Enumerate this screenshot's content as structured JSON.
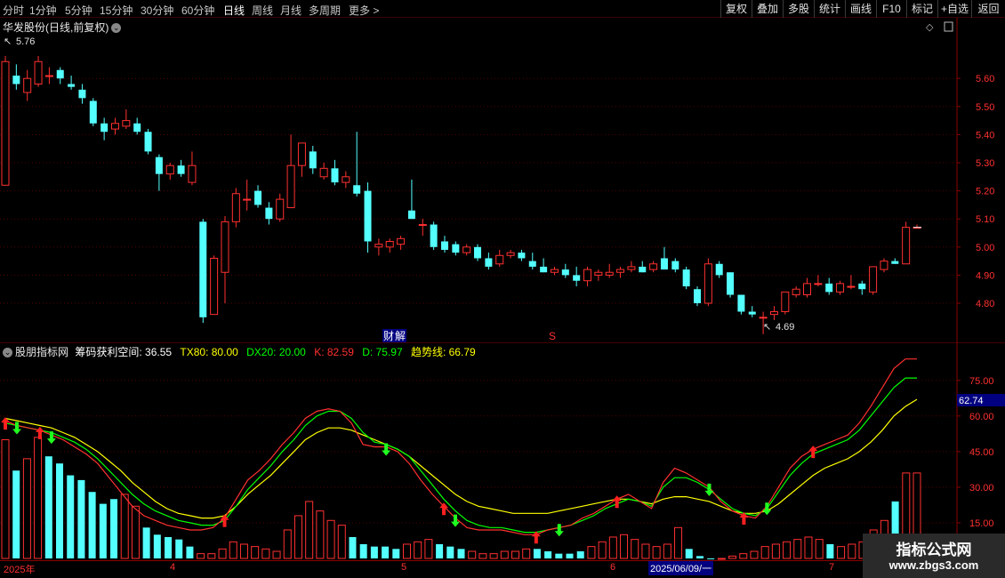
{
  "toolbar": {
    "timeframes": [
      "分时",
      "1分钟",
      "5分钟",
      "15分钟",
      "30分钟",
      "60分钟",
      "日线",
      "周线",
      "月线",
      "多周期",
      "更多 >"
    ],
    "active_timeframe": "日线",
    "right_buttons": [
      "复权",
      "叠加",
      "多股",
      "统计",
      "画线",
      "F10",
      "标记",
      "+自选",
      "返回"
    ]
  },
  "main": {
    "title": "华发股份(日线,前复权)",
    "high_label": "5.76",
    "low_label": "4.69",
    "price_ticks": [
      "5.60",
      "5.50",
      "5.40",
      "5.30",
      "5.20",
      "5.10",
      "5.00",
      "4.90",
      "4.80"
    ],
    "event_caiji": "财",
    "event_jie": "解",
    "event_s": "S"
  },
  "indicator": {
    "name": "股朋指标网",
    "items": [
      {
        "label": "筹码获利空间: 36.55",
        "color": "#ffffff"
      },
      {
        "label": "TX80: 80.00",
        "color": "#ffff00"
      },
      {
        "label": "DX20: 20.00",
        "color": "#00ff00"
      },
      {
        "label": "K: 82.59",
        "color": "#ff3030"
      },
      {
        "label": "D: 75.97",
        "color": "#00ff00"
      },
      {
        "label": "趋势线: 66.79",
        "color": "#ffff00"
      }
    ],
    "ticks": [
      "75.00",
      "60.00",
      "45.00",
      "30.00",
      "15.00"
    ],
    "current_value": "62.74"
  },
  "xaxis": {
    "labels": [
      "2025年",
      "4",
      "5",
      "6",
      "2025/06/09/一",
      "7"
    ]
  },
  "watermark": {
    "line1": "指标公式网",
    "line2": "www.zbgs3.com"
  },
  "colors": {
    "up": "#ff3030",
    "down": "#54ffff",
    "grid": "#8b0000",
    "k_line": "#ff3030",
    "d_line": "#00ff00",
    "trend_line": "#ffff00"
  },
  "chart_data": [
    {
      "type": "candlestick",
      "title": "华发股份(日线,前复权)",
      "ylim": [
        4.69,
        5.76
      ],
      "candles": [
        {
          "o": 5.22,
          "h": 5.68,
          "l": 5.22,
          "c": 5.66
        },
        {
          "o": 5.61,
          "h": 5.65,
          "l": 5.56,
          "c": 5.58
        },
        {
          "o": 5.55,
          "h": 5.63,
          "l": 5.52,
          "c": 5.6
        },
        {
          "o": 5.58,
          "h": 5.68,
          "l": 5.57,
          "c": 5.66
        },
        {
          "o": 5.61,
          "h": 5.64,
          "l": 5.58,
          "c": 5.61
        },
        {
          "o": 5.63,
          "h": 5.64,
          "l": 5.58,
          "c": 5.6
        },
        {
          "o": 5.58,
          "h": 5.61,
          "l": 5.56,
          "c": 5.57
        },
        {
          "o": 5.56,
          "h": 5.58,
          "l": 5.51,
          "c": 5.53
        },
        {
          "o": 5.52,
          "h": 5.53,
          "l": 5.43,
          "c": 5.44
        },
        {
          "o": 5.44,
          "h": 5.46,
          "l": 5.38,
          "c": 5.41
        },
        {
          "o": 5.42,
          "h": 5.46,
          "l": 5.4,
          "c": 5.44
        },
        {
          "o": 5.43,
          "h": 5.49,
          "l": 5.42,
          "c": 5.45
        },
        {
          "o": 5.44,
          "h": 5.46,
          "l": 5.4,
          "c": 5.41
        },
        {
          "o": 5.41,
          "h": 5.42,
          "l": 5.33,
          "c": 5.34
        },
        {
          "o": 5.32,
          "h": 5.33,
          "l": 5.2,
          "c": 5.26
        },
        {
          "o": 5.26,
          "h": 5.3,
          "l": 5.24,
          "c": 5.29
        },
        {
          "o": 5.29,
          "h": 5.31,
          "l": 5.25,
          "c": 5.26
        },
        {
          "o": 5.23,
          "h": 5.34,
          "l": 5.22,
          "c": 5.29
        },
        {
          "o": 5.09,
          "h": 5.1,
          "l": 4.73,
          "c": 4.75
        },
        {
          "o": 4.76,
          "h": 4.97,
          "l": 4.76,
          "c": 4.96
        },
        {
          "o": 4.91,
          "h": 5.11,
          "l": 4.8,
          "c": 5.09
        },
        {
          "o": 5.09,
          "h": 5.21,
          "l": 5.07,
          "c": 5.19
        },
        {
          "o": 5.17,
          "h": 5.24,
          "l": 5.13,
          "c": 5.17
        },
        {
          "o": 5.2,
          "h": 5.22,
          "l": 5.14,
          "c": 5.15
        },
        {
          "o": 5.14,
          "h": 5.16,
          "l": 5.08,
          "c": 5.1
        },
        {
          "o": 5.1,
          "h": 5.19,
          "l": 5.09,
          "c": 5.17
        },
        {
          "o": 5.14,
          "h": 5.4,
          "l": 5.14,
          "c": 5.29
        },
        {
          "o": 5.29,
          "h": 5.37,
          "l": 5.25,
          "c": 5.37
        },
        {
          "o": 5.34,
          "h": 5.36,
          "l": 5.26,
          "c": 5.28
        },
        {
          "o": 5.25,
          "h": 5.3,
          "l": 5.24,
          "c": 5.28
        },
        {
          "o": 5.28,
          "h": 5.31,
          "l": 5.22,
          "c": 5.23
        },
        {
          "o": 5.23,
          "h": 5.27,
          "l": 5.21,
          "c": 5.25
        },
        {
          "o": 5.22,
          "h": 5.41,
          "l": 5.18,
          "c": 5.19
        },
        {
          "o": 5.2,
          "h": 5.23,
          "l": 4.98,
          "c": 5.02
        },
        {
          "o": 5.0,
          "h": 5.03,
          "l": 4.97,
          "c": 5.01
        },
        {
          "o": 5.0,
          "h": 5.03,
          "l": 4.98,
          "c": 5.02
        },
        {
          "o": 5.01,
          "h": 5.04,
          "l": 4.99,
          "c": 5.03
        },
        {
          "o": 5.13,
          "h": 5.24,
          "l": 5.1,
          "c": 5.1
        },
        {
          "o": 5.08,
          "h": 5.1,
          "l": 5.04,
          "c": 5.08
        },
        {
          "o": 5.08,
          "h": 5.09,
          "l": 4.99,
          "c": 5.0
        },
        {
          "o": 5.02,
          "h": 5.04,
          "l": 4.98,
          "c": 4.99
        },
        {
          "o": 5.01,
          "h": 5.02,
          "l": 4.97,
          "c": 4.98
        },
        {
          "o": 4.98,
          "h": 5.01,
          "l": 4.97,
          "c": 5.0
        },
        {
          "o": 5.0,
          "h": 5.01,
          "l": 4.95,
          "c": 4.96
        },
        {
          "o": 4.96,
          "h": 4.98,
          "l": 4.92,
          "c": 4.93
        },
        {
          "o": 4.94,
          "h": 4.99,
          "l": 4.93,
          "c": 4.97
        },
        {
          "o": 4.97,
          "h": 4.99,
          "l": 4.96,
          "c": 4.98
        },
        {
          "o": 4.98,
          "h": 4.99,
          "l": 4.95,
          "c": 4.96
        },
        {
          "o": 4.95,
          "h": 4.98,
          "l": 4.92,
          "c": 4.93
        },
        {
          "o": 4.93,
          "h": 4.96,
          "l": 4.91,
          "c": 4.91
        },
        {
          "o": 4.91,
          "h": 4.93,
          "l": 4.9,
          "c": 4.92
        },
        {
          "o": 4.92,
          "h": 4.94,
          "l": 4.89,
          "c": 4.9
        },
        {
          "o": 4.9,
          "h": 4.93,
          "l": 4.86,
          "c": 4.88
        },
        {
          "o": 4.88,
          "h": 4.93,
          "l": 4.86,
          "c": 4.92
        },
        {
          "o": 4.9,
          "h": 4.92,
          "l": 4.88,
          "c": 4.91
        },
        {
          "o": 4.9,
          "h": 4.94,
          "l": 4.89,
          "c": 4.91
        },
        {
          "o": 4.91,
          "h": 4.93,
          "l": 4.89,
          "c": 4.92
        },
        {
          "o": 4.92,
          "h": 4.95,
          "l": 4.91,
          "c": 4.93
        },
        {
          "o": 4.93,
          "h": 4.95,
          "l": 4.91,
          "c": 4.91
        },
        {
          "o": 4.92,
          "h": 4.95,
          "l": 4.91,
          "c": 4.94
        },
        {
          "o": 4.96,
          "h": 5.0,
          "l": 4.95,
          "c": 4.92
        },
        {
          "o": 4.95,
          "h": 4.96,
          "l": 4.91,
          "c": 4.92
        },
        {
          "o": 4.92,
          "h": 4.93,
          "l": 4.85,
          "c": 4.86
        },
        {
          "o": 4.85,
          "h": 4.86,
          "l": 4.79,
          "c": 4.8
        },
        {
          "o": 4.8,
          "h": 4.96,
          "l": 4.79,
          "c": 4.94
        },
        {
          "o": 4.94,
          "h": 4.95,
          "l": 4.89,
          "c": 4.9
        },
        {
          "o": 4.91,
          "h": 4.91,
          "l": 4.82,
          "c": 4.83
        },
        {
          "o": 4.83,
          "h": 4.83,
          "l": 4.76,
          "c": 4.77
        },
        {
          "o": 4.77,
          "h": 4.79,
          "l": 4.75,
          "c": 4.76
        },
        {
          "o": 4.75,
          "h": 4.77,
          "l": 4.69,
          "c": 4.75
        },
        {
          "o": 4.76,
          "h": 4.79,
          "l": 4.74,
          "c": 4.77
        },
        {
          "o": 4.77,
          "h": 4.81,
          "l": 4.76,
          "c": 4.84
        },
        {
          "o": 4.83,
          "h": 4.86,
          "l": 4.82,
          "c": 4.85
        },
        {
          "o": 4.83,
          "h": 4.89,
          "l": 4.82,
          "c": 4.87
        },
        {
          "o": 4.87,
          "h": 4.9,
          "l": 4.86,
          "c": 4.87
        },
        {
          "o": 4.87,
          "h": 4.89,
          "l": 4.83,
          "c": 4.84
        },
        {
          "o": 4.84,
          "h": 4.88,
          "l": 4.83,
          "c": 4.87
        },
        {
          "o": 4.86,
          "h": 4.9,
          "l": 4.85,
          "c": 4.86
        },
        {
          "o": 4.87,
          "h": 4.88,
          "l": 4.83,
          "c": 4.85
        },
        {
          "o": 4.84,
          "h": 4.9,
          "l": 4.83,
          "c": 4.93
        },
        {
          "o": 4.92,
          "h": 4.96,
          "l": 4.91,
          "c": 4.95
        },
        {
          "o": 4.95,
          "h": 4.96,
          "l": 4.94,
          "c": 4.94
        },
        {
          "o": 4.94,
          "h": 5.09,
          "l": 4.94,
          "c": 5.07
        },
        {
          "o": 5.07,
          "h": 5.08,
          "l": 5.07,
          "c": 5.07
        }
      ]
    },
    {
      "type": "bar+line",
      "title": "股朋指标网",
      "ylim": [
        0,
        90
      ],
      "bar_values": [
        50,
        37,
        42,
        51,
        43,
        40,
        35,
        33,
        28,
        23,
        25,
        27,
        22,
        13,
        10,
        9,
        8,
        5,
        2,
        2,
        4,
        7,
        6,
        5,
        4,
        3,
        12,
        18,
        24,
        20,
        16,
        14,
        9,
        6,
        5,
        5,
        4,
        6,
        7,
        8,
        6,
        5,
        4,
        3,
        2,
        2,
        3,
        3,
        4,
        4,
        3,
        2,
        2,
        3,
        5,
        7,
        9,
        10,
        8,
        6,
        5,
        6,
        13,
        4,
        1,
        0,
        0,
        1,
        2,
        3,
        5,
        6,
        7,
        8,
        9,
        8,
        6,
        5,
        6,
        7,
        12,
        16,
        24,
        36,
        36
      ],
      "bar_up": [
        1,
        0,
        1,
        1,
        0,
        0,
        0,
        0,
        0,
        0,
        0,
        1,
        1,
        0,
        0,
        0,
        0,
        0,
        1,
        1,
        1,
        1,
        1,
        1,
        1,
        1,
        1,
        1,
        1,
        1,
        1,
        1,
        0,
        0,
        0,
        0,
        0,
        1,
        1,
        1,
        0,
        0,
        0,
        1,
        1,
        1,
        1,
        1,
        1,
        0,
        0,
        0,
        0,
        0,
        1,
        1,
        1,
        1,
        1,
        1,
        1,
        1,
        1,
        0,
        0,
        0,
        1,
        1,
        1,
        1,
        1,
        1,
        1,
        1,
        1,
        1,
        0,
        1,
        1,
        1,
        1,
        1,
        0,
        1,
        1
      ],
      "K": [
        58,
        56,
        55,
        54,
        52,
        50,
        47,
        44,
        40,
        34,
        28,
        22,
        18,
        16,
        14,
        13,
        12,
        12,
        13,
        17,
        25,
        33,
        37,
        42,
        48,
        53,
        59,
        62,
        63,
        62,
        57,
        48,
        47,
        47,
        45,
        40,
        33,
        27,
        22,
        17,
        13,
        12,
        12,
        12,
        11,
        10,
        10,
        12,
        13,
        14,
        17,
        19,
        22,
        25,
        27,
        24,
        21,
        32,
        38,
        36,
        33,
        30,
        24,
        20,
        18,
        17,
        22,
        30,
        38,
        43,
        46,
        48,
        50,
        52,
        57,
        64,
        72,
        80,
        84,
        84
      ],
      "D": [
        57,
        56,
        55,
        54,
        53,
        51,
        49,
        46,
        42,
        37,
        32,
        27,
        23,
        20,
        18,
        16,
        15,
        14,
        14,
        16,
        22,
        29,
        34,
        39,
        45,
        50,
        56,
        60,
        62,
        62,
        59,
        53,
        49,
        48,
        46,
        43,
        37,
        31,
        25,
        20,
        16,
        14,
        13,
        13,
        12,
        11,
        11,
        12,
        13,
        14,
        16,
        18,
        21,
        23,
        25,
        24,
        22,
        30,
        34,
        34,
        32,
        29,
        25,
        21,
        19,
        18,
        21,
        28,
        35,
        40,
        44,
        46,
        48,
        50,
        54,
        60,
        66,
        72,
        76,
        76
      ],
      "trend": [
        59,
        58,
        57,
        56,
        55,
        53,
        51,
        48,
        45,
        41,
        37,
        32,
        28,
        24,
        21,
        19,
        18,
        17,
        17,
        18,
        22,
        27,
        31,
        35,
        40,
        45,
        50,
        53,
        55,
        55,
        54,
        52,
        50,
        48,
        46,
        43,
        39,
        35,
        31,
        27,
        24,
        22,
        21,
        20,
        19,
        19,
        19,
        19,
        20,
        21,
        22,
        23,
        24,
        25,
        25,
        24,
        23,
        25,
        26,
        26,
        25,
        24,
        22,
        20,
        19,
        19,
        20,
        23,
        27,
        31,
        35,
        38,
        40,
        42,
        45,
        49,
        54,
        60,
        64,
        67
      ],
      "current_value": 62.74
    }
  ]
}
